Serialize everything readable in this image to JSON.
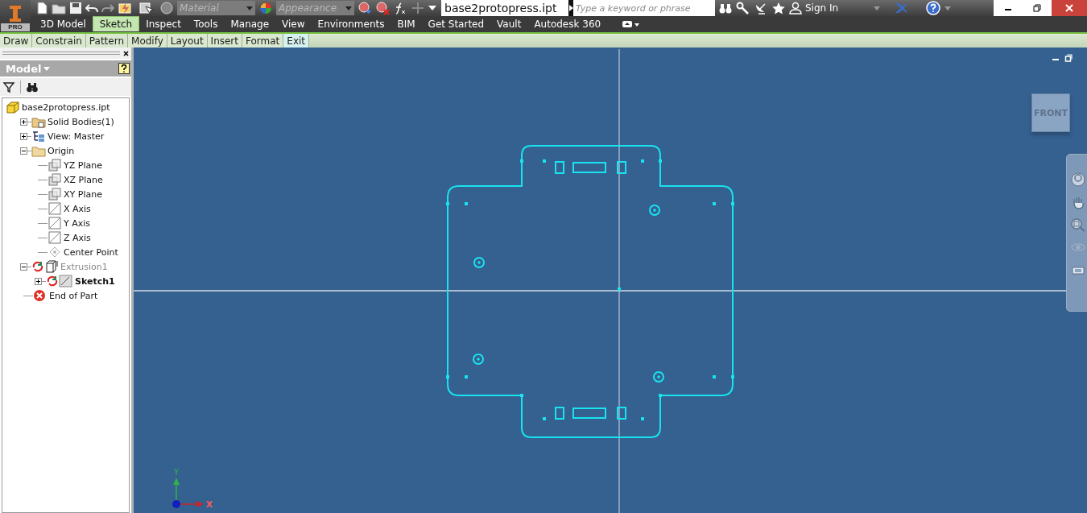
{
  "app_button": {
    "badge": "PRO"
  },
  "quick_access": {
    "material": {
      "placeholder": "Material"
    },
    "appearance": {
      "placeholder": "Appearance"
    }
  },
  "document_title": "base2protopress.ipt",
  "search": {
    "placeholder": "Type a keyword or phrase"
  },
  "sign_in": "Sign In",
  "ribbon_tabs": [
    {
      "label": "3D Model",
      "selected": false
    },
    {
      "label": "Sketch",
      "selected": true
    },
    {
      "label": "Inspect",
      "selected": false
    },
    {
      "label": "Tools",
      "selected": false
    },
    {
      "label": "Manage",
      "selected": false
    },
    {
      "label": "View",
      "selected": false
    },
    {
      "label": "Environments",
      "selected": false
    },
    {
      "label": "BIM",
      "selected": false
    },
    {
      "label": "Get Started",
      "selected": false
    },
    {
      "label": "Vault",
      "selected": false
    },
    {
      "label": "Autodesk 360",
      "selected": false
    }
  ],
  "panels": [
    {
      "label": "Draw",
      "highlighted": false
    },
    {
      "label": "Constrain",
      "highlighted": false
    },
    {
      "label": "Pattern",
      "highlighted": false
    },
    {
      "label": "Modify",
      "highlighted": false
    },
    {
      "label": "Layout",
      "highlighted": false
    },
    {
      "label": "Insert",
      "highlighted": false
    },
    {
      "label": "Format",
      "highlighted": false
    },
    {
      "label": "Exit",
      "highlighted": true
    }
  ],
  "browser": {
    "title": "Model",
    "tree": [
      {
        "label": "base2protopress.ipt",
        "kind": "part",
        "children": [
          {
            "label": "Solid Bodies(1)",
            "kind": "bodies",
            "expanded": false
          },
          {
            "label": "View: Master",
            "kind": "view",
            "expanded": false
          },
          {
            "label": "Origin",
            "kind": "folder",
            "expanded": true,
            "children": [
              {
                "label": "YZ Plane",
                "kind": "plane"
              },
              {
                "label": "XZ Plane",
                "kind": "plane"
              },
              {
                "label": "XY Plane",
                "kind": "plane"
              },
              {
                "label": "X Axis",
                "kind": "axis"
              },
              {
                "label": "Y Axis",
                "kind": "axis"
              },
              {
                "label": "Z Axis",
                "kind": "axis"
              },
              {
                "label": "Center Point",
                "kind": "point"
              }
            ]
          },
          {
            "label": "Extrusion1",
            "kind": "extrusion",
            "expanded": true,
            "dimmed": true,
            "children": [
              {
                "label": "Sketch1",
                "kind": "sketch",
                "expanded": false,
                "selected": true
              }
            ]
          },
          {
            "label": "End of Part",
            "kind": "end"
          }
        ]
      }
    ]
  },
  "view_cube": {
    "label": "FRONT"
  },
  "axis_triad": {
    "y": "Y",
    "x": "X"
  }
}
